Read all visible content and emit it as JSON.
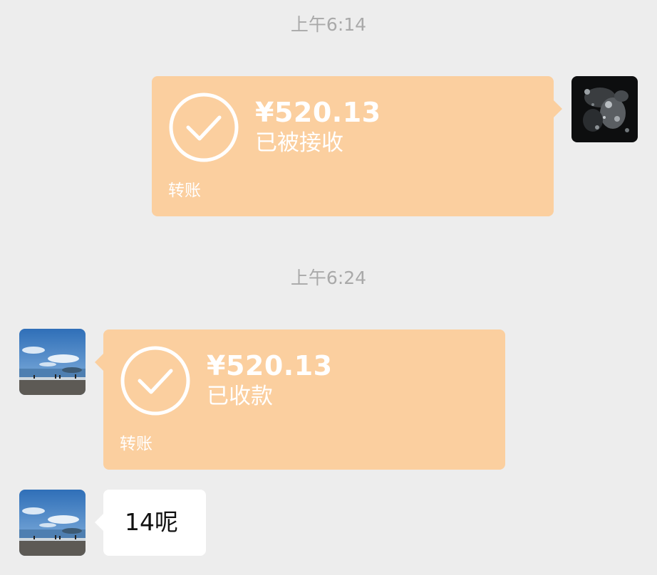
{
  "messages": [
    {
      "timestamp": "上午6:14",
      "transfer": {
        "amount": "¥520.13",
        "status": "已被接收",
        "label": "转账",
        "sender": "self"
      }
    },
    {
      "timestamp": "上午6:24",
      "transfer": {
        "amount": "¥520.13",
        "status": "已收款",
        "label": "转账",
        "sender": "other"
      }
    },
    {
      "text": "14呢",
      "sender": "other"
    }
  ],
  "colors": {
    "background": "#ededed",
    "transfer_bubble": "#fbcf9f",
    "text_bubble": "#ffffff",
    "timestamp": "#a9a9a9"
  },
  "icons": {
    "check": "check-circle-icon"
  }
}
